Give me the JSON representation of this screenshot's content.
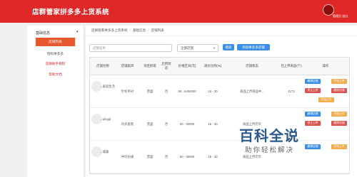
{
  "app": {
    "title": "店群管家拼多多上货系统",
    "user_name": "管理员 退出"
  },
  "sidebar": {
    "header": "基础信息",
    "items": [
      {
        "label": "店铺列表"
      },
      {
        "label": "授权拼多多"
      },
      {
        "label": "店群助手教程"
      },
      {
        "label": "帮助文档"
      }
    ]
  },
  "breadcrumb": {
    "items": [
      "店群管家拼多多上货系统",
      "基础信息",
      "店铺列表"
    ]
  },
  "toolbar": {
    "search_placeholder": "店铺名称",
    "select_value": "全部店铺",
    "search_button": "搜索",
    "add_button": "添加拼多多店铺"
  },
  "table": {
    "headers": [
      "店铺名称",
      "店铺类目",
      "淘宝抓取",
      "启用状态",
      "价格区间(元)",
      "调价比例(%)",
      "店铺状态",
      "已上传商品(个)",
      "操作"
    ],
    "rows": [
      {
        "name": "...家居生活",
        "category": "针织手衬",
        "source": "贯盛",
        "enabled": "否",
        "price": "50 - 5450000",
        "ratio": "15 - 30",
        "status": "商品上传商品中...",
        "count": "1173"
      },
      {
        "name": "...qingqi",
        "category": "内衣套装",
        "source": "贯盛",
        "enabled": "否",
        "price": "50 - 30000",
        "ratio": "15 - 30",
        "status": "商品上传完毕",
        "count": ""
      },
      {
        "name": "...城铺",
        "category": "中印长裙",
        "source": "贯盛",
        "enabled": "否",
        "price": "50 - 30000",
        "ratio": "15 - 30",
        "status": "商品上传完毕",
        "count": ""
      }
    ],
    "actions": {
      "edit": "编辑店铺",
      "upload": "开始上传",
      "stop": "停止上传",
      "delete": "删除店铺"
    }
  },
  "watermark": {
    "title": "百科全说",
    "subtitle": "助你轻松解决"
  }
}
